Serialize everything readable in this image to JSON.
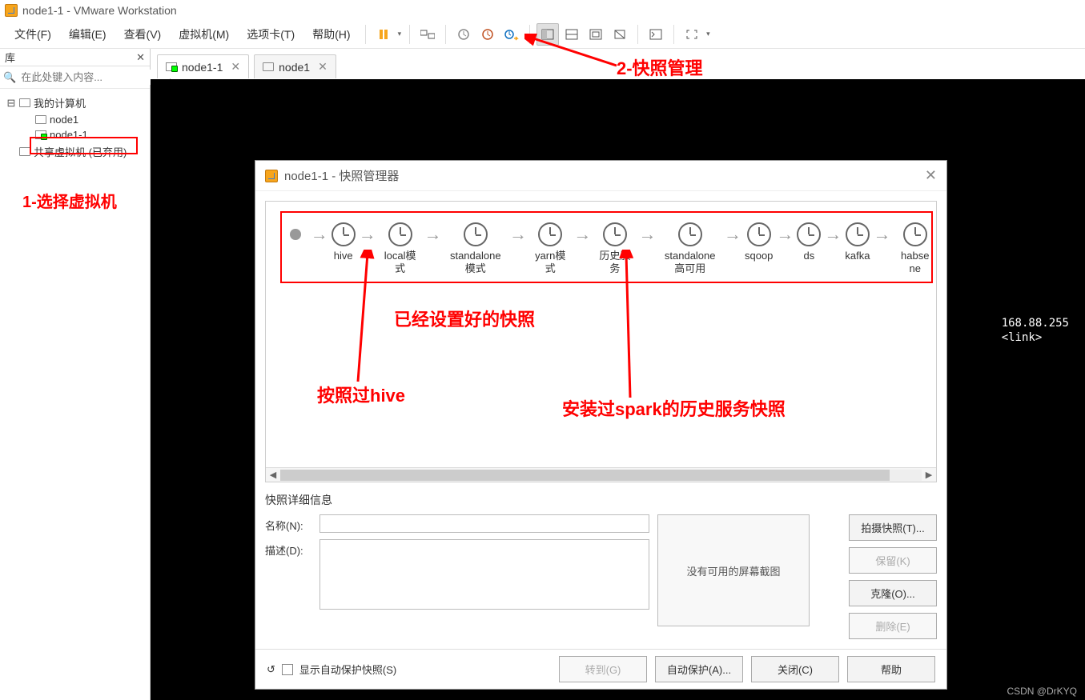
{
  "title_bar": {
    "text": "node1-1 - VMware Workstation"
  },
  "menu": {
    "file": "文件(F)",
    "edit": "编辑(E)",
    "view": "查看(V)",
    "vm": "虚拟机(M)",
    "tabs": "选项卡(T)",
    "help": "帮助(H)"
  },
  "sidebar": {
    "header": "库",
    "search_placeholder": "在此处键入内容...",
    "tree": {
      "root": "我的计算机",
      "node1": "node1",
      "node1_1": "node1-1",
      "shared": "共享虚拟机 (已弃用)"
    }
  },
  "tabs": {
    "t1": "node1-1",
    "t2": "node1"
  },
  "console": "168.88.255\n<link>",
  "dialog": {
    "title": "node1-1 - 快照管理器",
    "snapshots": [
      {
        "label": "hive"
      },
      {
        "label": "local模式"
      },
      {
        "label": "standalone模式"
      },
      {
        "label": "yarn模式"
      },
      {
        "label": "历史服务"
      },
      {
        "label": "standalone高可用"
      },
      {
        "label": "sqoop"
      },
      {
        "label": "ds"
      },
      {
        "label": "kafka"
      },
      {
        "label": "habse ne"
      }
    ],
    "details_title": "快照详细信息",
    "name_label": "名称(N):",
    "desc_label": "描述(D):",
    "no_screenshot": "没有可用的屏幕截图",
    "buttons": {
      "take": "拍摄快照(T)...",
      "keep": "保留(K)",
      "clone": "克隆(O)...",
      "delete": "删除(E)"
    },
    "footer": {
      "show_auto": "显示自动保护快照(S)",
      "goto": "转到(G)",
      "auto": "自动保护(A)...",
      "close": "关闭(C)",
      "help": "帮助"
    }
  },
  "annotations": {
    "a1": "1-选择虚拟机",
    "a2": "2-快照管理",
    "a3": "已经设置好的快照",
    "a4": "按照过hive",
    "a5": "安装过spark的历史服务快照"
  },
  "watermark": "CSDN @DrKYQ"
}
